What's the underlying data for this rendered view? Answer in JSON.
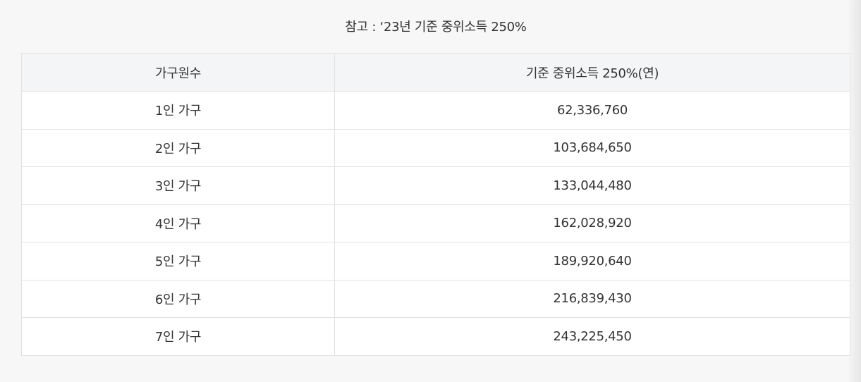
{
  "caption": "참고 : ‘23년 기준 중위소득 250%",
  "table": {
    "headers": [
      "가구원수",
      "기준 중위소득 250%(연)"
    ],
    "rows": [
      [
        "1인 가구",
        "62,336,760"
      ],
      [
        "2인 가구",
        "103,684,650"
      ],
      [
        "3인 가구",
        "133,044,480"
      ],
      [
        "4인 가구",
        "162,028,920"
      ],
      [
        "5인 가구",
        "189,920,640"
      ],
      [
        "6인 가구",
        "216,839,430"
      ],
      [
        "7인 가구",
        "243,225,450"
      ]
    ]
  }
}
